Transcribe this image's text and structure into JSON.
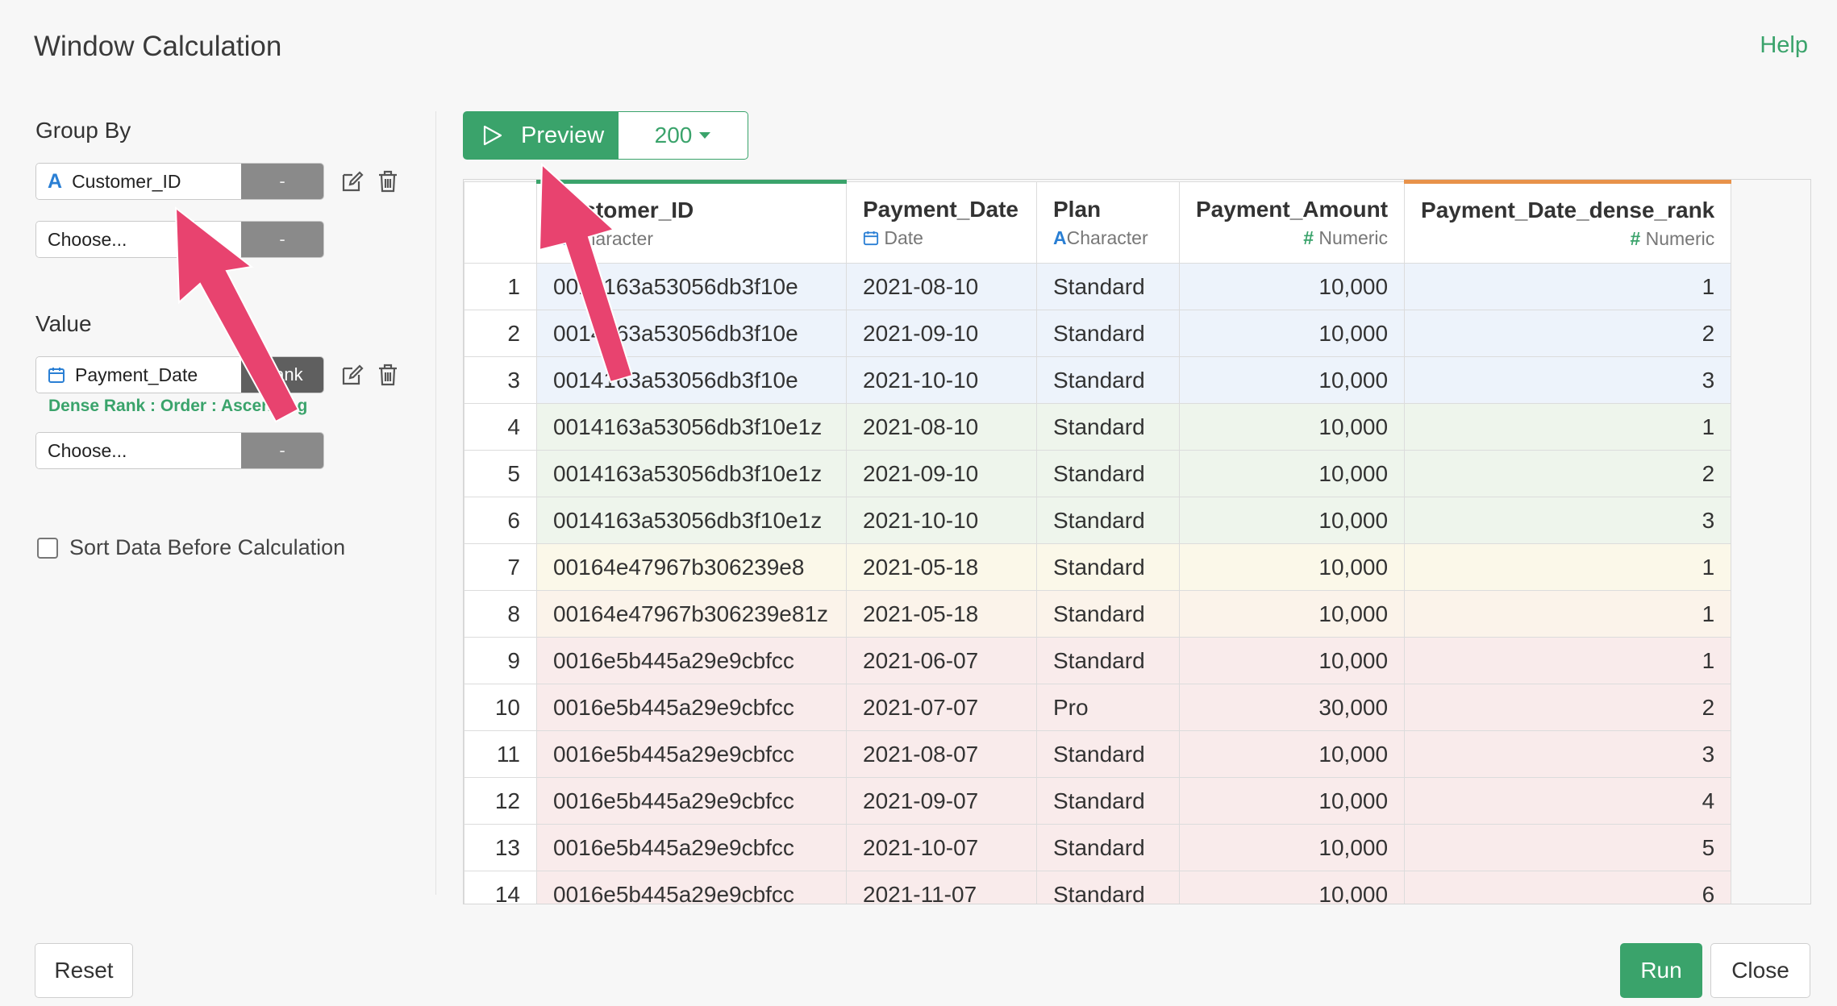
{
  "dialog": {
    "title": "Window Calculation",
    "help_label": "Help"
  },
  "left_panel": {
    "group_by_label": "Group By",
    "group_by_field": {
      "name": "Customer_ID",
      "tag": "-",
      "type_icon": "character-icon"
    },
    "group_by_choose": {
      "placeholder": "Choose...",
      "tag": "-"
    },
    "value_label": "Value",
    "value_field": {
      "name": "Payment_Date",
      "tag": "Rank",
      "type_icon": "calendar-icon"
    },
    "value_description": "Dense Rank : Order : Ascending",
    "value_choose": {
      "placeholder": "Choose...",
      "tag": "-"
    },
    "sort_checkbox_label": "Sort Data Before Calculation",
    "sort_checked": false
  },
  "preview": {
    "button_label": "Preview",
    "row_count": "200"
  },
  "table": {
    "columns": [
      {
        "name": "Customer_ID",
        "type": "Character",
        "type_icon": "character-icon",
        "accent": "#3aa36b"
      },
      {
        "name": "Payment_Date",
        "type": "Date",
        "type_icon": "calendar-icon"
      },
      {
        "name": "Plan",
        "type": "Character",
        "type_icon": "character-icon"
      },
      {
        "name": "Payment_Amount",
        "type": "Numeric",
        "type_icon": "hash-icon"
      },
      {
        "name": "Payment_Date_dense_rank",
        "type": "Numeric",
        "type_icon": "hash-icon",
        "accent": "#e8924a"
      }
    ],
    "rows": [
      {
        "idx": "1",
        "customer_id": "0014163a53056db3f10e",
        "payment_date": "2021-08-10",
        "plan": "Standard",
        "amount": "10,000",
        "rank": "1"
      },
      {
        "idx": "2",
        "customer_id": "0014163a53056db3f10e",
        "payment_date": "2021-09-10",
        "plan": "Standard",
        "amount": "10,000",
        "rank": "2"
      },
      {
        "idx": "3",
        "customer_id": "0014163a53056db3f10e",
        "payment_date": "2021-10-10",
        "plan": "Standard",
        "amount": "10,000",
        "rank": "3"
      },
      {
        "idx": "4",
        "customer_id": "0014163a53056db3f10e1z",
        "payment_date": "2021-08-10",
        "plan": "Standard",
        "amount": "10,000",
        "rank": "1"
      },
      {
        "idx": "5",
        "customer_id": "0014163a53056db3f10e1z",
        "payment_date": "2021-09-10",
        "plan": "Standard",
        "amount": "10,000",
        "rank": "2"
      },
      {
        "idx": "6",
        "customer_id": "0014163a53056db3f10e1z",
        "payment_date": "2021-10-10",
        "plan": "Standard",
        "amount": "10,000",
        "rank": "3"
      },
      {
        "idx": "7",
        "customer_id": "00164e47967b306239e8",
        "payment_date": "2021-05-18",
        "plan": "Standard",
        "amount": "10,000",
        "rank": "1"
      },
      {
        "idx": "8",
        "customer_id": "00164e47967b306239e81z",
        "payment_date": "2021-05-18",
        "plan": "Standard",
        "amount": "10,000",
        "rank": "1"
      },
      {
        "idx": "9",
        "customer_id": "0016e5b445a29e9cbfcc",
        "payment_date": "2021-06-07",
        "plan": "Standard",
        "amount": "10,000",
        "rank": "1"
      },
      {
        "idx": "10",
        "customer_id": "0016e5b445a29e9cbfcc",
        "payment_date": "2021-07-07",
        "plan": "Pro",
        "amount": "30,000",
        "rank": "2"
      },
      {
        "idx": "11",
        "customer_id": "0016e5b445a29e9cbfcc",
        "payment_date": "2021-08-07",
        "plan": "Standard",
        "amount": "10,000",
        "rank": "3"
      },
      {
        "idx": "12",
        "customer_id": "0016e5b445a29e9cbfcc",
        "payment_date": "2021-09-07",
        "plan": "Standard",
        "amount": "10,000",
        "rank": "4"
      },
      {
        "idx": "13",
        "customer_id": "0016e5b445a29e9cbfcc",
        "payment_date": "2021-10-07",
        "plan": "Standard",
        "amount": "10,000",
        "rank": "5"
      },
      {
        "idx": "14",
        "customer_id": "0016e5b445a29e9cbfcc",
        "payment_date": "2021-11-07",
        "plan": "Standard",
        "amount": "10,000",
        "rank": "6"
      }
    ]
  },
  "footer": {
    "reset_label": "Reset",
    "run_label": "Run",
    "close_label": "Close"
  },
  "colors": {
    "accent_green": "#3aa36b",
    "annotation_arrow": "#e8436f",
    "group_row_colors": [
      "#edf3fb",
      "#eef5ec",
      "#fbf8e9",
      "#fbf3ea",
      "#f9ebeb"
    ]
  }
}
